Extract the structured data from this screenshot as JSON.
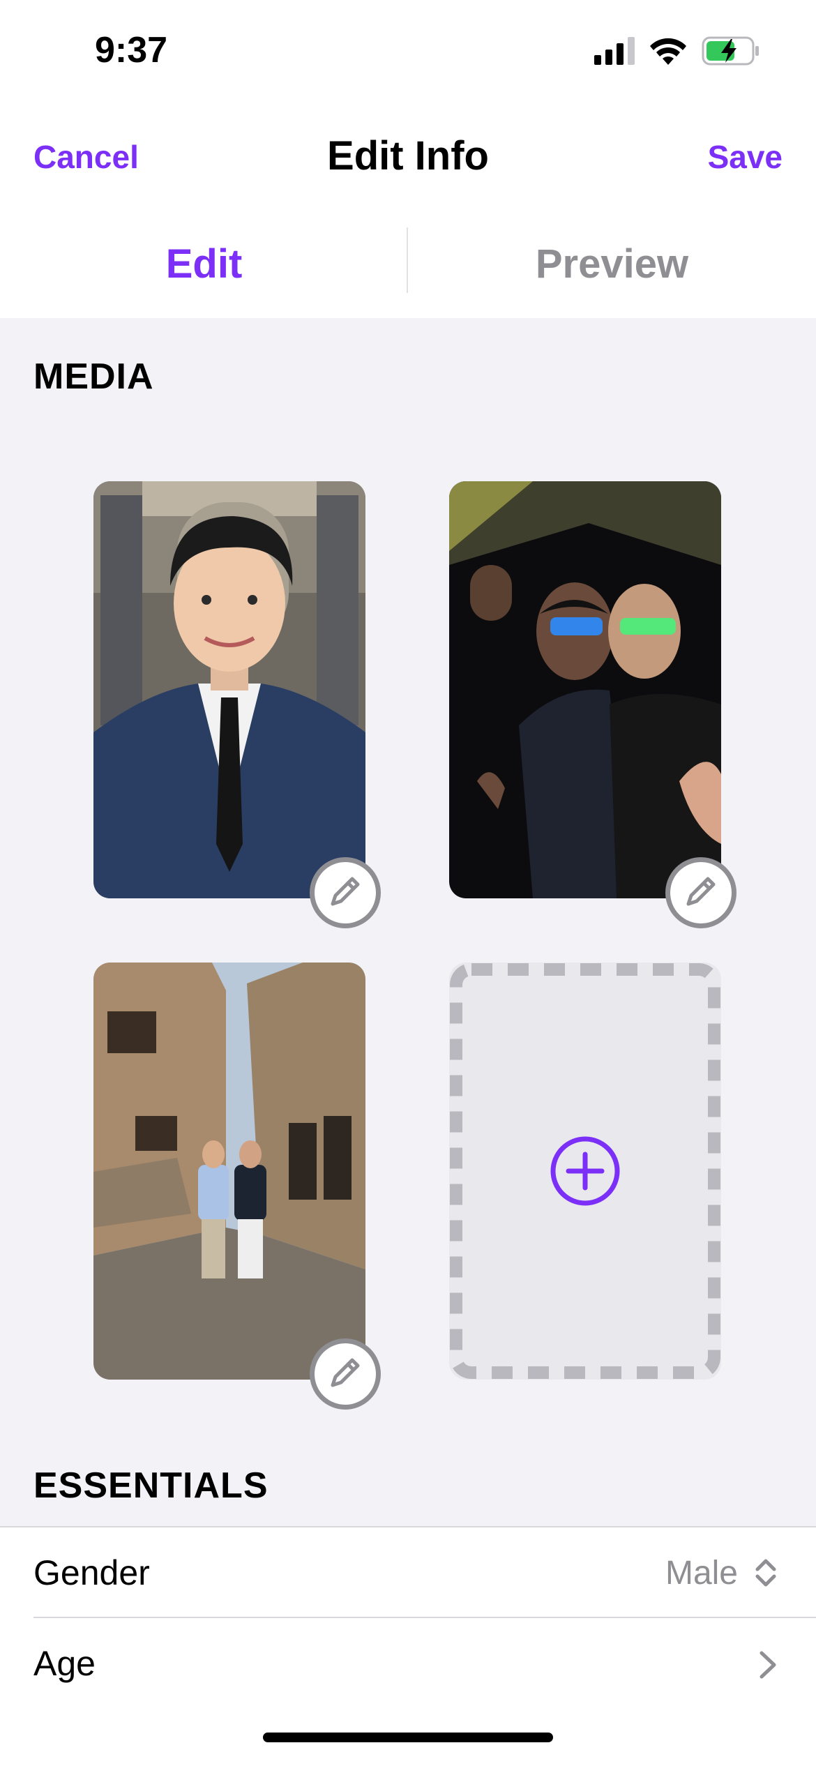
{
  "status_bar": {
    "time": "9:37",
    "icons": [
      "signal-icon",
      "wifi-icon",
      "battery-charging-icon"
    ]
  },
  "nav": {
    "cancel_label": "Cancel",
    "title": "Edit Info",
    "save_label": "Save"
  },
  "tabs": [
    {
      "label": "Edit",
      "active": true
    },
    {
      "label": "Preview",
      "active": false
    }
  ],
  "media": {
    "header": "MEDIA",
    "photos": [
      {
        "description_icon": "photo-portrait"
      },
      {
        "description_icon": "photo-party"
      },
      {
        "description_icon": "photo-street"
      }
    ],
    "edit_icon": "pencil-icon",
    "add_icon": "plus-circle-icon"
  },
  "essentials": {
    "header": "ESSENTIALS",
    "rows": [
      {
        "label": "Gender",
        "value": "Male",
        "accessory": "chevron-up-down-icon"
      },
      {
        "label": "Age",
        "value": "",
        "accessory": "chevron-right-icon"
      }
    ]
  },
  "colors": {
    "accent": "#7b2ff7",
    "secondary_text": "#8e8e93",
    "background": "#f2f2f7"
  }
}
